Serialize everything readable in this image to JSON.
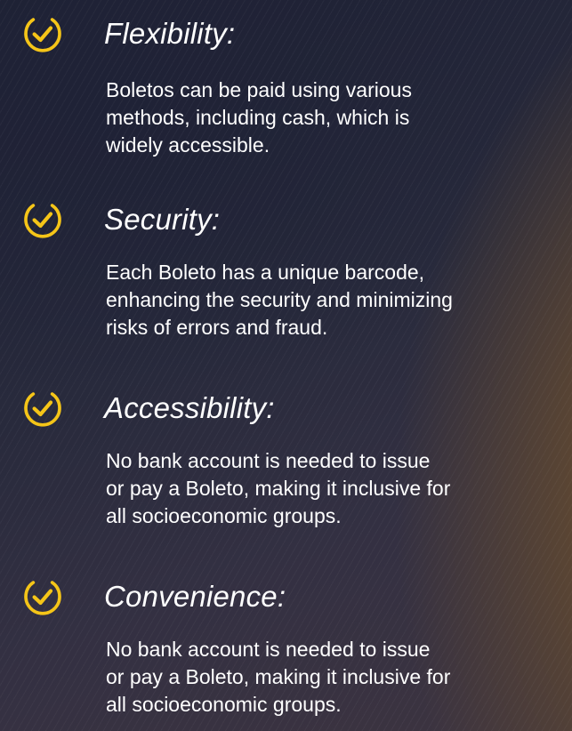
{
  "features": [
    {
      "icon": "check-circle-icon",
      "title": "Flexibility:",
      "description_lines": [
        "Boletos can be paid using various",
        "methods, including cash, which is",
        "widely accessible."
      ]
    },
    {
      "icon": "check-circle-icon",
      "title": "Security:",
      "description_lines": [
        "Each Boleto has a unique barcode,",
        "enhancing the security and minimizing",
        "risks of errors and fraud."
      ]
    },
    {
      "icon": "check-circle-icon",
      "title": "Accessibility:",
      "description_lines": [
        "No bank account is needed to issue",
        "or pay a Boleto, making it inclusive for",
        "all socioeconomic groups."
      ]
    },
    {
      "icon": "check-circle-icon",
      "title": "Convenience:",
      "description_lines": [
        "No bank account is needed to issue",
        "or pay a Boleto, making it inclusive for",
        "all socioeconomic groups."
      ]
    }
  ],
  "colors": {
    "accent": "#f5c518"
  }
}
